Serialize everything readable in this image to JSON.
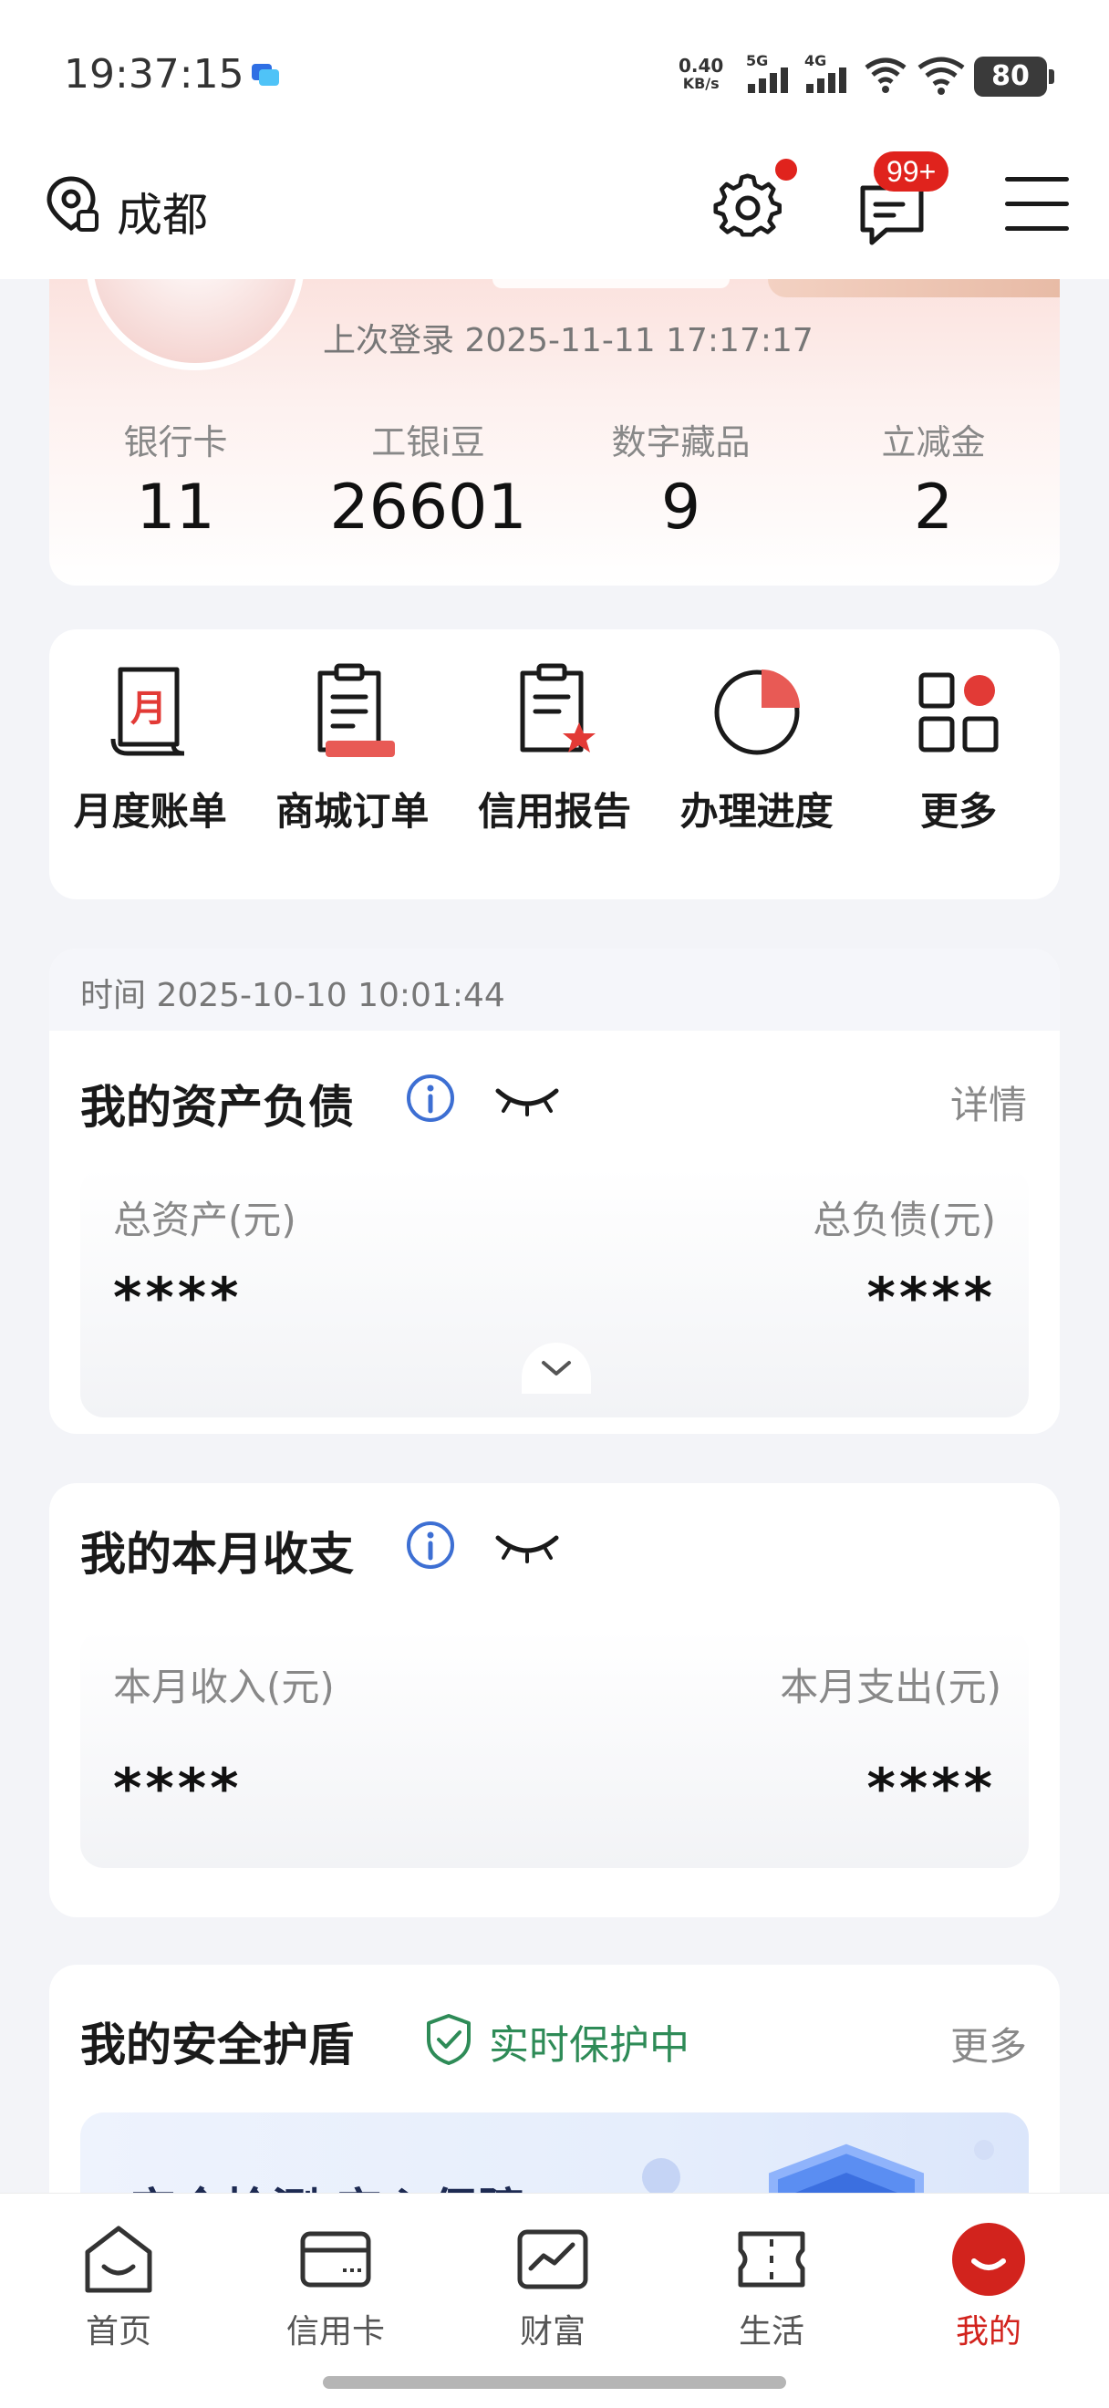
{
  "status_bar": {
    "time": "19:37:15",
    "net_speed_value": "0.40",
    "net_speed_unit": "KB/s",
    "signal_1": "5G",
    "signal_2": "4G",
    "battery": "80"
  },
  "header": {
    "location": "成都",
    "message_badge": "99+"
  },
  "profile": {
    "last_login": "上次登录 2025-11-11 17:17:17",
    "stats": [
      {
        "label": "银行卡",
        "value": "11"
      },
      {
        "label": "工银i豆",
        "value": "26601"
      },
      {
        "label": "数字藏品",
        "value": "9"
      },
      {
        "label": "立减金",
        "value": "2"
      }
    ]
  },
  "shortcuts": [
    {
      "label": "月度账单",
      "icon": "monthly-bill-icon",
      "glyph": "月"
    },
    {
      "label": "商城订单",
      "icon": "mall-order-icon"
    },
    {
      "label": "信用报告",
      "icon": "credit-report-icon"
    },
    {
      "label": "办理进度",
      "icon": "progress-icon"
    },
    {
      "label": "更多",
      "icon": "more-grid-icon"
    }
  ],
  "assets": {
    "time": "时间 2025-10-10 10:01:44",
    "title": "我的资产负债",
    "detail_link": "详情",
    "total_assets_label": "总资产(元)",
    "total_assets_value": "****",
    "total_liabilities_label": "总负债(元)",
    "total_liabilities_value": "****"
  },
  "monthly": {
    "title": "我的本月收支",
    "income_label": "本月收入(元)",
    "income_value": "****",
    "expense_label": "本月支出(元)",
    "expense_value": "****"
  },
  "shield": {
    "title": "我的安全护盾",
    "status": "实时保护中",
    "more_link": "更多",
    "banner_title": "安全检测 安心保障"
  },
  "bottom_nav": [
    {
      "label": "首页",
      "icon": "home-icon",
      "active": false
    },
    {
      "label": "信用卡",
      "icon": "credit-card-icon",
      "active": false
    },
    {
      "label": "财富",
      "icon": "wealth-chart-icon",
      "active": false
    },
    {
      "label": "生活",
      "icon": "life-ticket-icon",
      "active": false
    },
    {
      "label": "我的",
      "icon": "my-icon",
      "active": true
    }
  ],
  "colors": {
    "brand_red": "#d2231d",
    "badge_red": "#e0231d",
    "info_blue": "#3d6fd3",
    "safe_green": "#2e8b57"
  }
}
